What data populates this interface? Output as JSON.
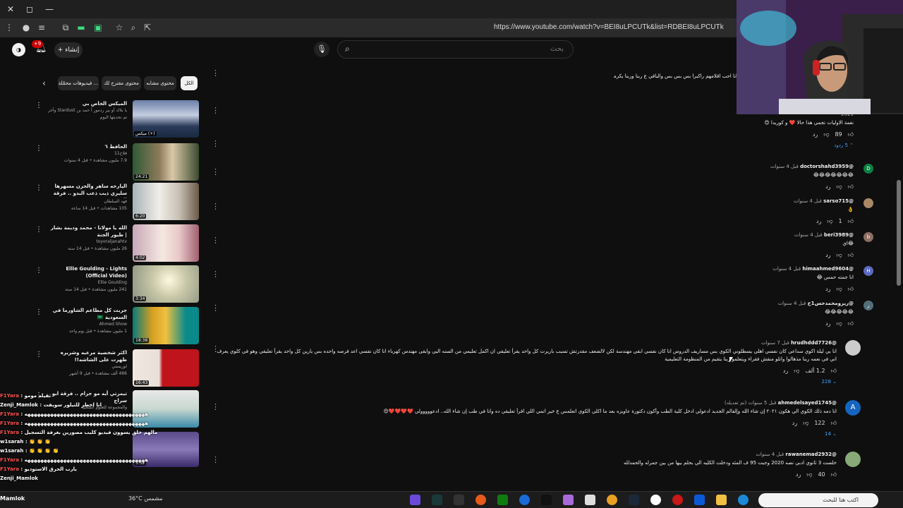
{
  "browser": {
    "url": "https://www.youtube.com/watch?v=BEI8uLPCUTk&list=RDBEI8uLPCUTk"
  },
  "header": {
    "notification_count": "+9",
    "create_label": "إنشاء",
    "search_placeholder": "بحث",
    "search_value": ""
  },
  "chips": [
    "الكل",
    "محتوى مشابه",
    "محتوى مقترح لك",
    "فيديوهات محمّلة ..."
  ],
  "related": [
    {
      "title": "الميكس الخاص بي",
      "channel": "يا بلاك أو بير ردمور أ حمد بن Stardust وآخرين آخر",
      "meta": "تم تحديثها اليوم",
      "duration": "ميكس (+)"
    },
    {
      "title": "الحافظ ٦",
      "channel": "فلاح11",
      "meta": "7.9 مليون مشاهدة • قبل 4 سنوات",
      "duration": "24:21"
    },
    {
      "title": "اليارحه ساهر والحزن مسهرها سليري ذيب ذعب البدو .. فرقة المصينين 2025",
      "channel": "فهد السلطان",
      "meta": "105 مشاهدات • قبل 14 ساعة",
      "duration": "6:20"
    },
    {
      "title": "الله يا مولانا - محمد وديمة بشار | طيور الجنة",
      "channel": "toyoraljanahtv",
      "meta": "26 مليون مشاهدة • قبل 14 سنة",
      "duration": "4:02"
    },
    {
      "title": "Ellie Goulding - Lights (Official Video)",
      "channel": "Ellie Goulding",
      "meta": "241 مليون مشاهدة • قبل 14 سنة",
      "duration": "3:34"
    },
    {
      "title": "جربت كل مطاعم الشاورما في السعودية 🇸🇦",
      "channel": "Ahmed Show",
      "meta": "1 مليون مشاهدة • قبل يوم واحد",
      "duration": "18:38"
    },
    {
      "title": "اكثر شخصية مرعبه وشريره ظهرت على الشاشه!!",
      "channel": "لوريستي",
      "meta": "466 ألف مشاهدة • قبل 9 أشهر",
      "duration": "16:43"
    },
    {
      "title": "تيمزتي أيه مو حرام .. فرقة ابو سراج",
      "channel": "والمجموعة للعلوم الشعبية",
      "meta": "",
      "duration": ""
    },
    {
      "title": "",
      "channel": "",
      "meta": "",
      "duration": "3:52"
    }
  ],
  "chat": [
    {
      "name": "F1Yara",
      "msg": "ثقيله مومو"
    },
    {
      "name": "Zenji_Mamlok",
      "msg": "انا اخطر للتيلور سويفت"
    },
    {
      "name": "F1Yara",
      "msg": "هههههههههههههههههههههههههههههههههههههه"
    },
    {
      "name": "F1Yara",
      "msg": "هههههههههههههههههههههههههههههههههههههه"
    },
    {
      "name": "F1Yara",
      "msg": "مالهم خلق يسوون فيديو كليب مصورين بغرفة التسجيل"
    },
    {
      "name": "w1sarah",
      "msg": "👏 👏 👏"
    },
    {
      "name": "w1sarah",
      "msg": "👏 👏 👏 👏"
    },
    {
      "name": "F1Yara",
      "msg": "هههههههههههههههههههههههههههههههههههههه"
    },
    {
      "name": "F1Yara",
      "msg": "يارب الحرق الاستوديو"
    },
    {
      "name": "Zenji_Mamlok",
      "msg": ""
    }
  ],
  "top_text": "انا احب اقلامهم راكبرا بس بس بس والباقي ع ربنا وربنا يكرمكم",
  "comments": [
    {
      "handle": "",
      "time": "2021",
      "body": "نغمة الاوليات تجمي هذا حالا ❤️ و كوريدا 😊",
      "likes": "89",
      "replies": "5 ردود",
      "avatar": "",
      "avatar_color": "#555"
    },
    {
      "handle": "@doctorshahd3959",
      "time": "قبل 4 سنوات",
      "body": "😂😂😂😂😂😂😂",
      "likes": "",
      "replies": "",
      "avatar": "D",
      "avatar_color": "#0b8043"
    },
    {
      "handle": "@sarso715",
      "time": "قبل 4 سنوات",
      "body": "👌",
      "likes": "1",
      "replies": "",
      "avatar": "",
      "avatar_color": "#a86"
    },
    {
      "handle": "@beri3989",
      "time": "قبل 4 سنوات",
      "body": "😂اي",
      "likes": "",
      "replies": "",
      "avatar": "b",
      "avatar_color": "#8d6e63"
    },
    {
      "handle": "@himaahmed9604",
      "time": "قبل 4 سنوات",
      "body": "انا جمته حمس 😂",
      "likes": "",
      "replies": "",
      "avatar": "H",
      "avatar_color": "#5c6bc0"
    },
    {
      "handle": "@ريزومحمدحس1ح",
      "time": "قبل 4 سنوات",
      "body": "😂😂😂😂😂",
      "likes": "",
      "replies": "",
      "avatar": "ر",
      "avatar_color": "#546e7a"
    },
    {
      "handle": "@hrudhddd7726",
      "time": "قبل 7 سنوات",
      "body": "انا بي ليلة اكوي سداعي كان نفسي اهلي يسطلوني الكوي بس مساريف الدروس انا كان نفسي ابقى مهندسة لكن لالضعف مقدرتش تسبب باريرت كل واحد يقرأ تعليقي ان اكمل تعليمي من السنه اليي وابقى مهندس كهرباء انا كان نفسي اعد فرصه واحده بس يارين كل واحد يقرأ تعليقي وهو في كلوي يعرف اني في نعمه ربنا مذهالوا واتلو منقش فقراء ويتعلمو ربنا يتقيم من المنظومة التعليمية",
      "likes": "1.2 ألف",
      "replies": "228",
      "avatar": "",
      "avatar_color": "#ccc"
    },
    {
      "handle": "@ahmedelsayed1745",
      "time": "قبل 5 سنوات (تم تعديله)",
      "body": "انا دمه ذلك الكوي الي هكون ٢٠٢١ إن شاء الله وإلفالم الجديد ادعولي ادخل كلية الطب وأكون دكتورة عاويزه بعد ما اكلي الكوي اتعلمس ع خير اتمي اللي اقرأ تعليقي ده وانا في طب إن شاء الله.. ادعووووولي ❤️❤️❤️❤️😍",
      "likes": "122",
      "replies": "14",
      "avatar": "A",
      "avatar_color": "#1565c0"
    },
    {
      "handle": "@rawanemad2932",
      "time": "قبل 4 سنوات",
      "body": "خلصت 3 ثانوي ادبي نصه 2020 وجبت 95 ف المئه ودخلت الكليه الي بحلم بيها من بين جمرله والحمدلله",
      "likes": "40",
      "replies": "",
      "avatar": "",
      "avatar_color": "#8a7"
    }
  ],
  "taskbar": {
    "search_placeholder": "اكتب هنا للبحث",
    "weather": "36°C مشمس",
    "user": "Mamlok"
  }
}
